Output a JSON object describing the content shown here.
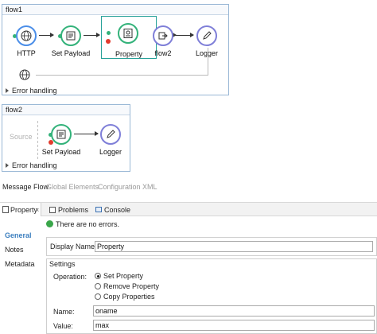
{
  "flow1": {
    "title": "flow1",
    "components": [
      {
        "label": "HTTP",
        "icon": "globe-icon"
      },
      {
        "label": "Set Payload",
        "icon": "payload-icon"
      },
      {
        "label": "Property",
        "icon": "property-icon"
      },
      {
        "label": "flow2",
        "icon": "flow-ref-icon"
      },
      {
        "label": "Logger",
        "icon": "logger-icon"
      }
    ],
    "error_handling": "Error handling"
  },
  "flow2": {
    "title": "flow2",
    "source_label": "Source",
    "components": [
      {
        "label": "Set Payload",
        "icon": "payload-icon"
      },
      {
        "label": "Logger",
        "icon": "logger-icon"
      }
    ],
    "error_handling": "Error handling"
  },
  "editor_tabs": [
    "Message Flow",
    "Global Elements",
    "Configuration XML"
  ],
  "panel": {
    "tabs": {
      "property": "Property",
      "close": "×",
      "problems": "Problems",
      "console": "Console"
    },
    "sidebar": [
      "General",
      "Notes",
      "Metadata"
    ],
    "status": "There are no errors.",
    "display_name_label": "Display Name:",
    "display_name_value": "Property",
    "settings_title": "Settings",
    "operation_label": "Operation:",
    "operations": [
      "Set Property",
      "Remove Property",
      "Copy Properties"
    ],
    "selected_operation": "Set Property",
    "name_label": "Name:",
    "name_value": "oname",
    "value_label": "Value:",
    "value_value": "max"
  },
  "colors": {
    "accent_green": "#33b27a",
    "accent_blue": "#4b8ee8",
    "error_red": "#e23b2e",
    "selection_teal": "#27a199"
  }
}
